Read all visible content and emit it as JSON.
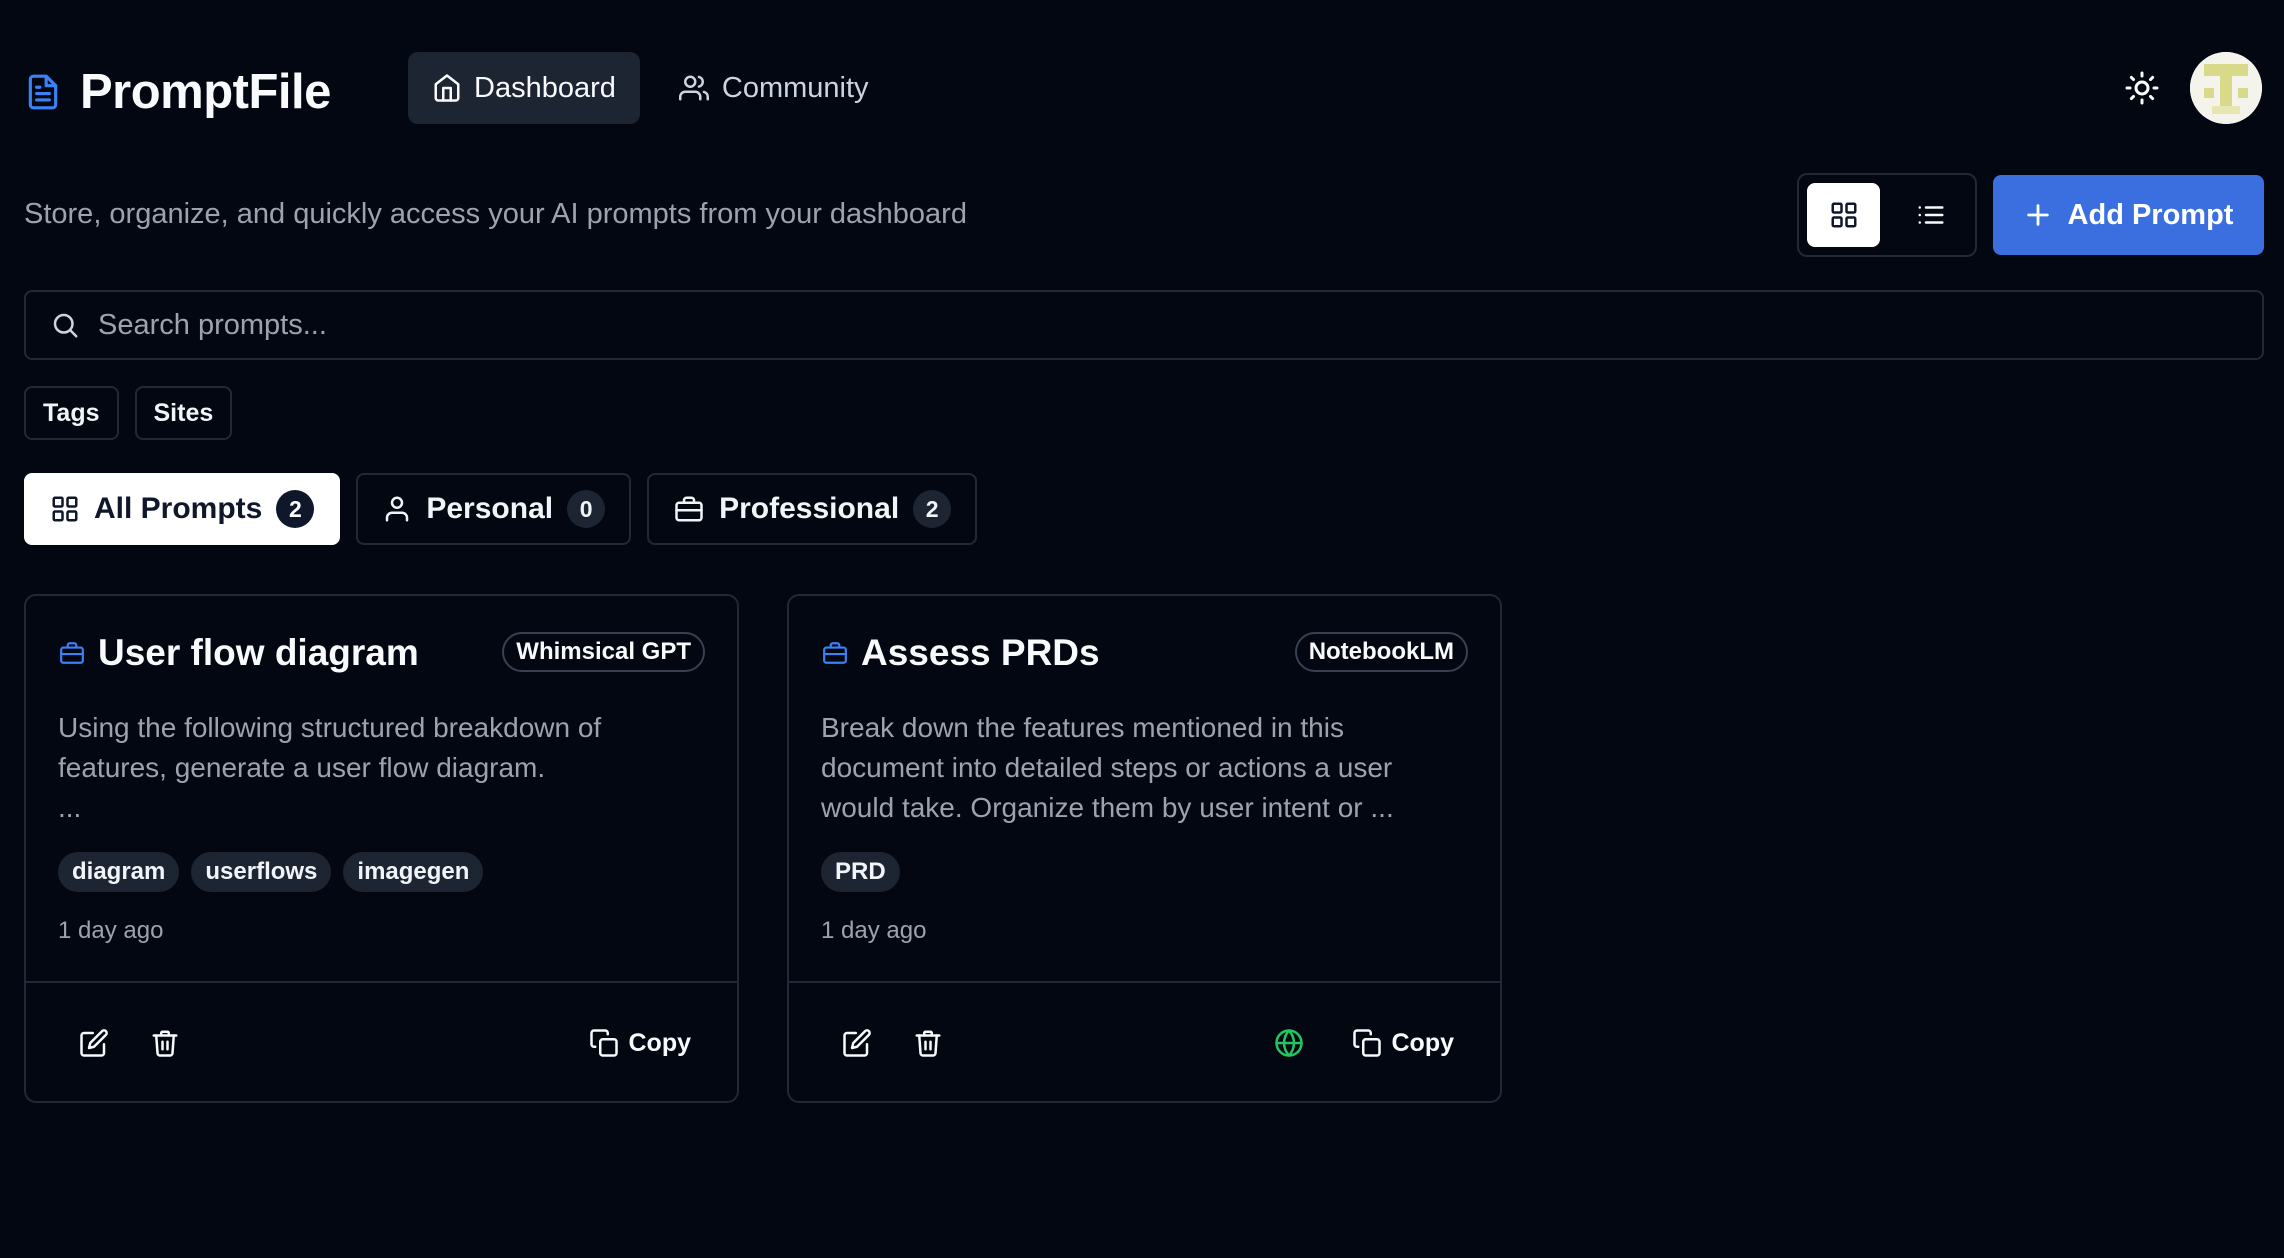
{
  "header": {
    "brand": "PromptFile",
    "nav": [
      {
        "label": "Dashboard",
        "active": true
      },
      {
        "label": "Community",
        "active": false
      }
    ]
  },
  "toolbar": {
    "subtitle": "Store, organize, and quickly access your AI prompts from your dashboard",
    "add_label": "Add Prompt",
    "view": "grid"
  },
  "search": {
    "placeholder": "Search prompts..."
  },
  "filters": [
    "Tags",
    "Sites"
  ],
  "categories": [
    {
      "label": "All Prompts",
      "count": "2",
      "active": true
    },
    {
      "label": "Personal",
      "count": "0",
      "active": false
    },
    {
      "label": "Professional",
      "count": "2",
      "active": false
    }
  ],
  "prompts": [
    {
      "title": "User flow diagram",
      "site": "Whimsical GPT",
      "body": "Using the following structured breakdown of features, generate a user flow diagram.\n...",
      "tags": [
        "diagram",
        "userflows",
        "imagegen"
      ],
      "time": "1 day ago",
      "copy_label": "Copy",
      "public": false
    },
    {
      "title": "Assess PRDs",
      "site": "NotebookLM",
      "body": "Break down the features mentioned in this document into detailed steps or actions a user would take. Organize them by user intent or ...",
      "tags": [
        "PRD"
      ],
      "time": "1 day ago",
      "copy_label": "Copy",
      "public": true
    }
  ],
  "colors": {
    "background": "#030712",
    "accent": "#3b6fe0",
    "border": "#1f2937",
    "muted_text": "#9ca3af",
    "public_icon": "#22c55e"
  }
}
